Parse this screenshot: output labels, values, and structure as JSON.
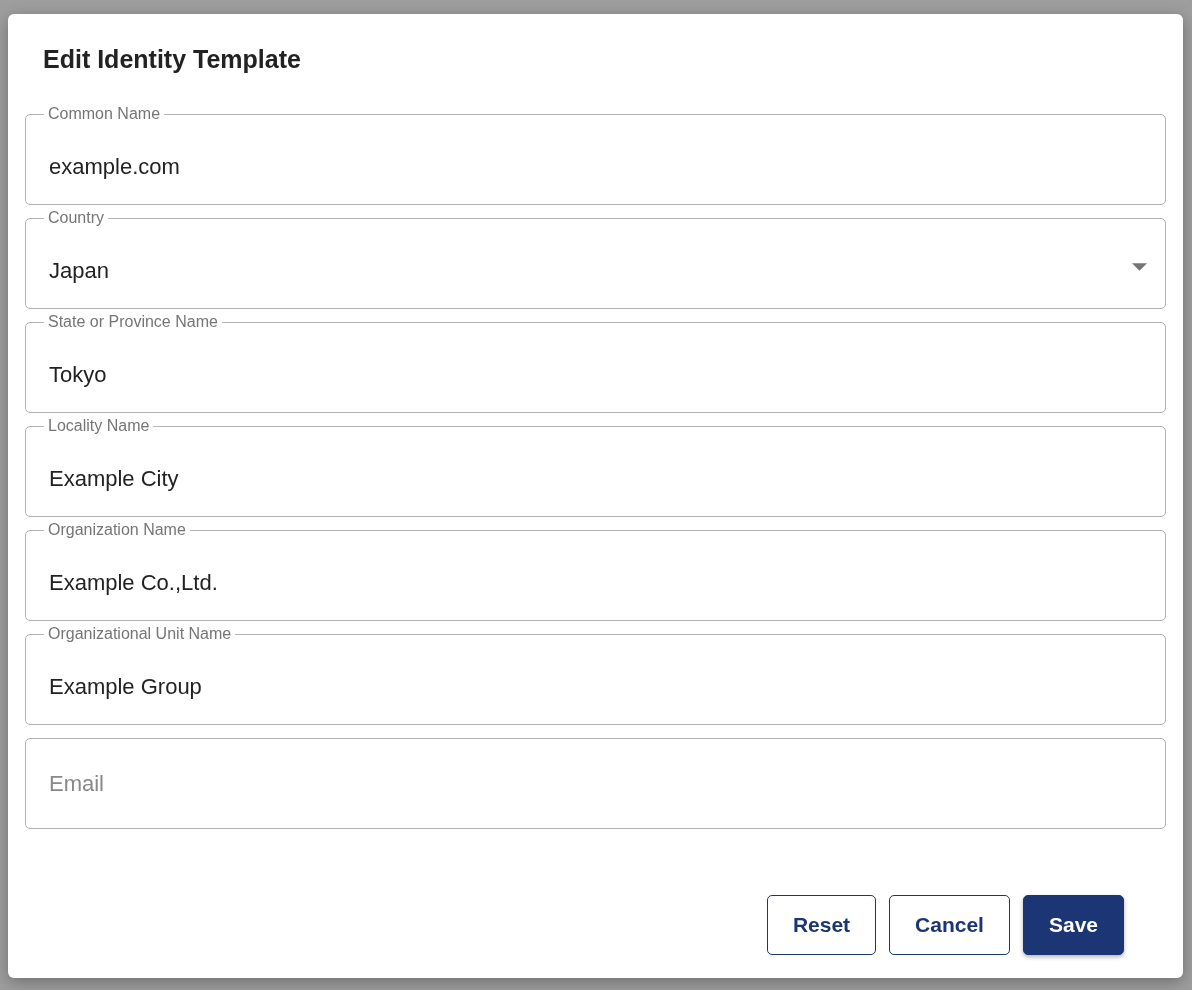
{
  "dialog": {
    "title": "Edit Identity Template",
    "fields": [
      {
        "kind": "text",
        "label": "Common Name",
        "value": "example.com"
      },
      {
        "kind": "select",
        "label": "Country",
        "value": "Japan"
      },
      {
        "kind": "text",
        "label": "State or Province Name",
        "value": "Tokyo"
      },
      {
        "kind": "text",
        "label": "Locality Name",
        "value": "Example City"
      },
      {
        "kind": "text",
        "label": "Organization Name",
        "value": "Example Co.,Ltd."
      },
      {
        "kind": "text",
        "label": "Organizational Unit Name",
        "value": "Example Group"
      },
      {
        "kind": "text",
        "placeholder": "Email"
      }
    ],
    "buttons": [
      {
        "label": "Reset",
        "primary": false
      },
      {
        "label": "Cancel",
        "primary": false
      },
      {
        "label": "Save",
        "primary": true
      }
    ]
  }
}
